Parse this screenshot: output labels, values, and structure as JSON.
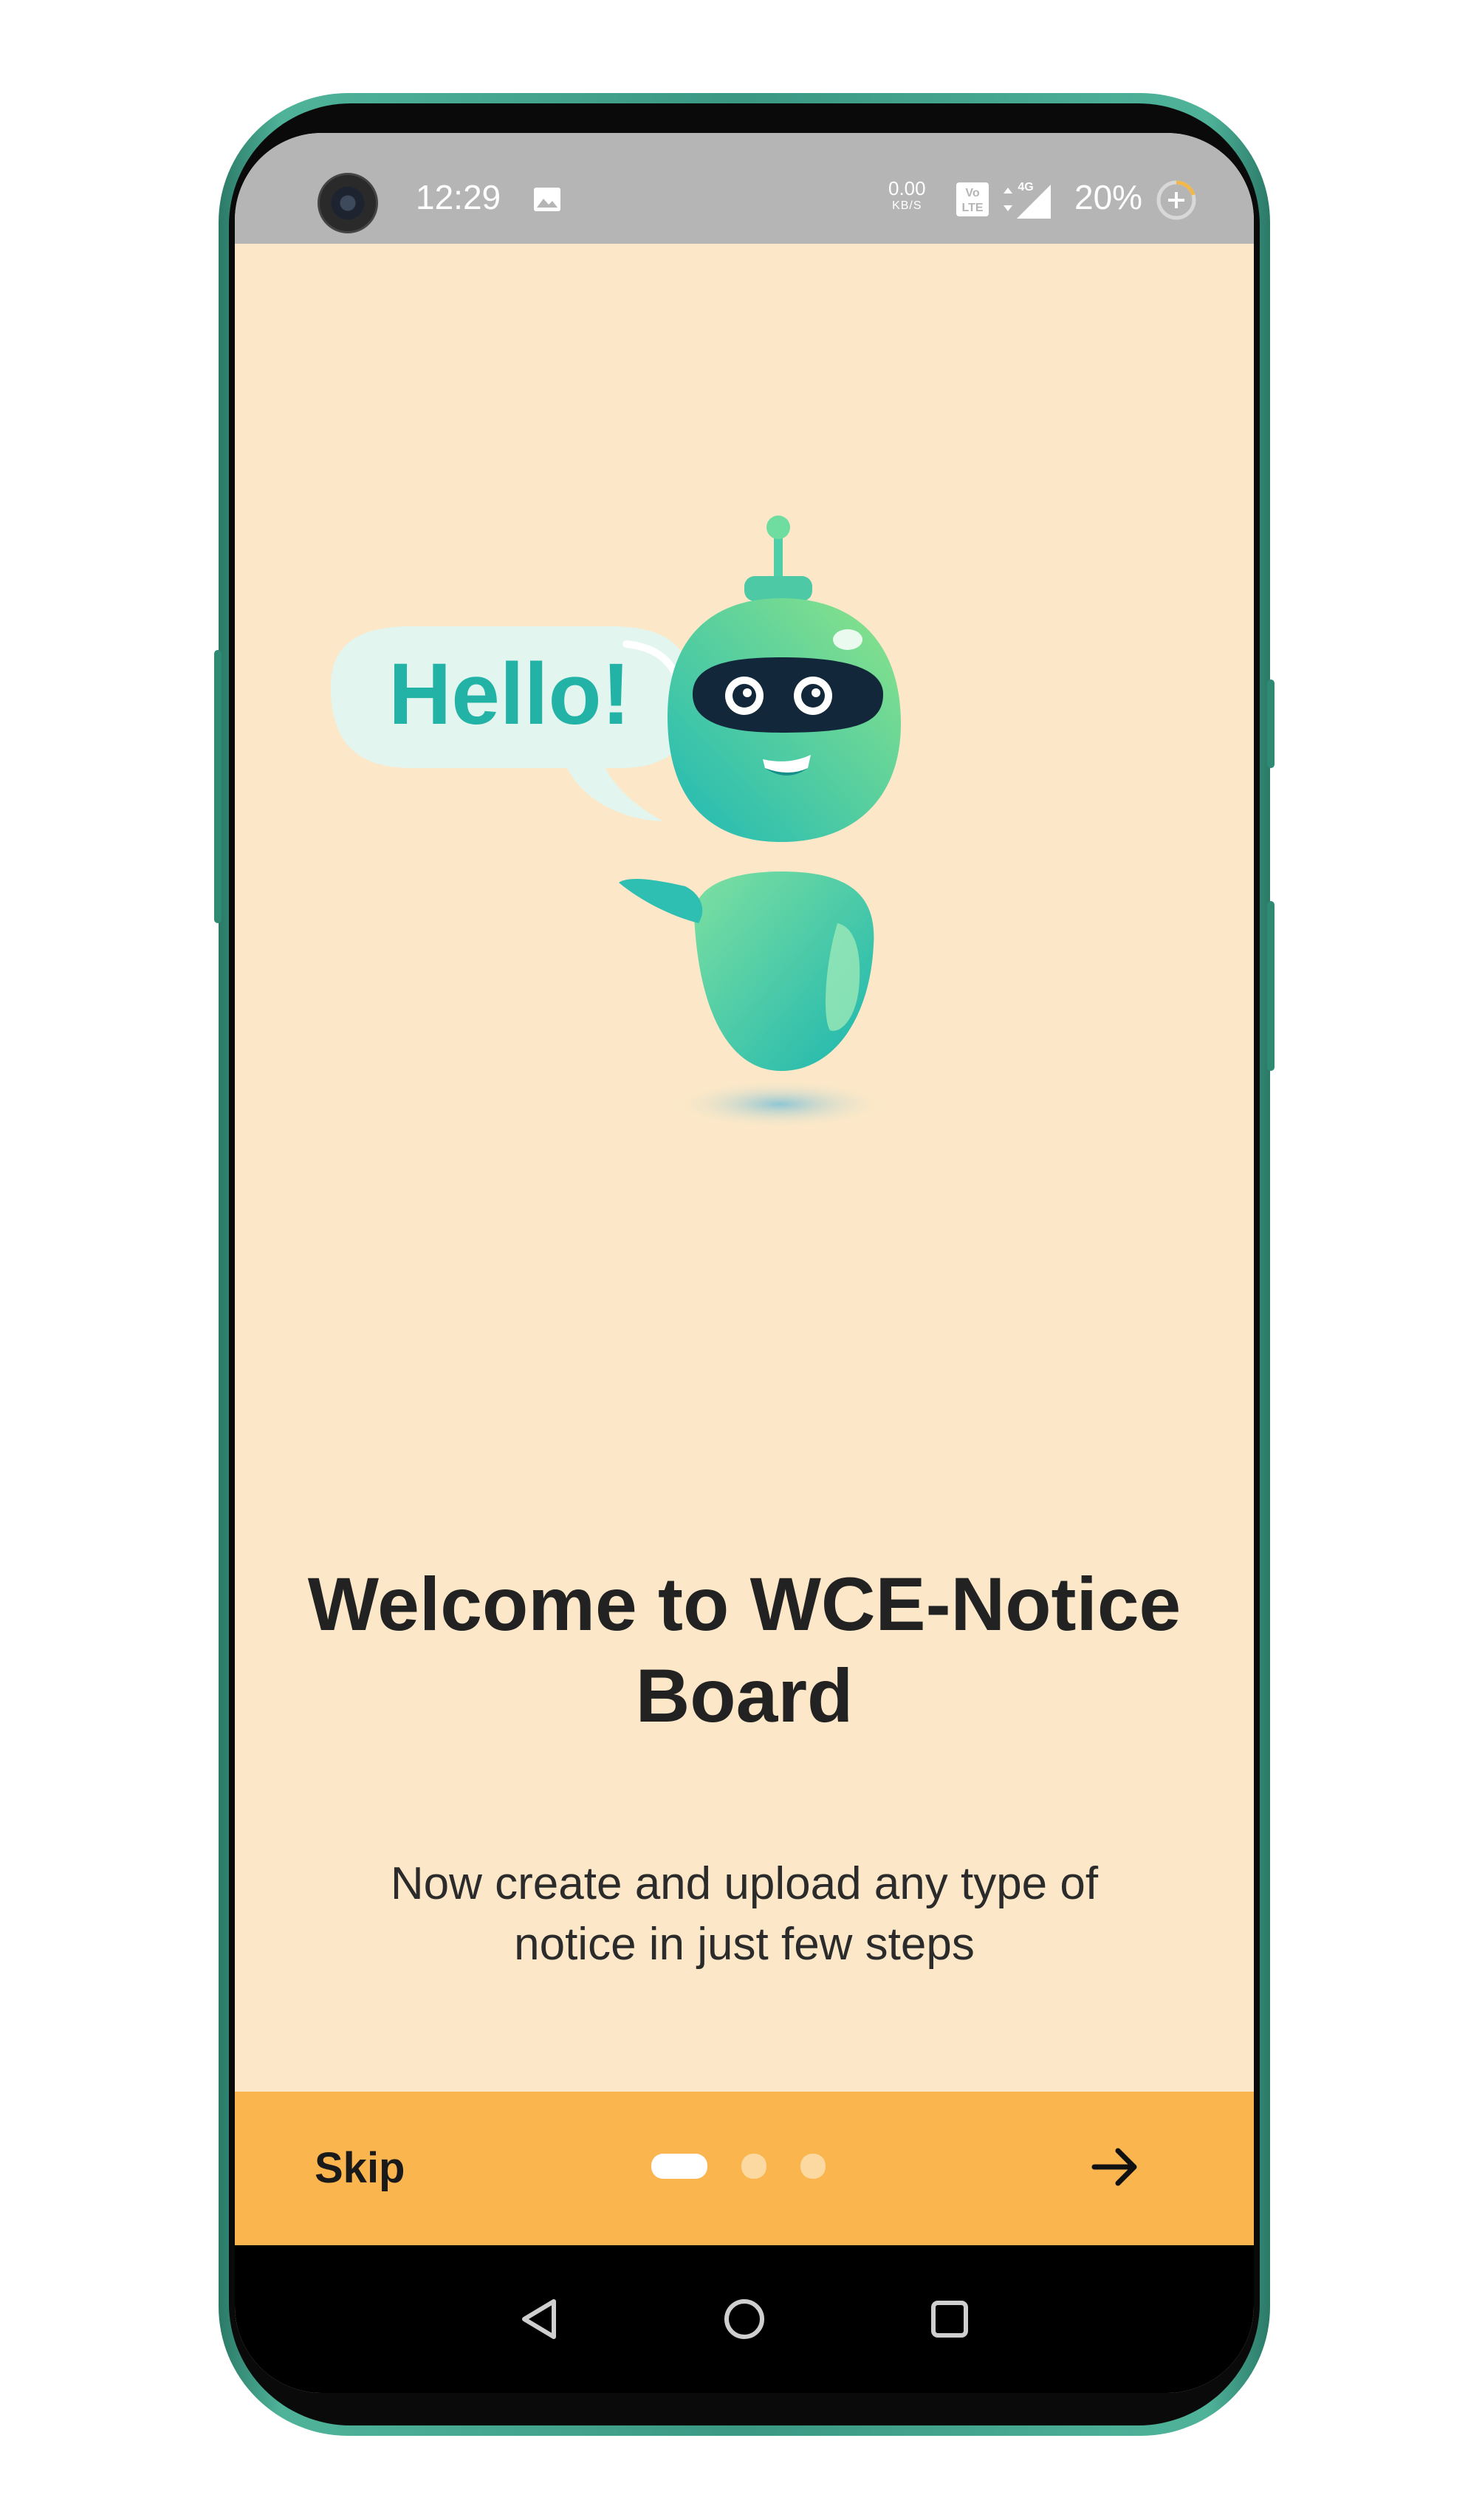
{
  "status_bar": {
    "time": "12:29",
    "net_speed_value": "0.00",
    "net_speed_unit": "KB/S",
    "volte_label_top": "Vo",
    "volte_label_bottom": "LTE",
    "network_type": "4G",
    "battery_percent": "20%",
    "icons": [
      "camera-icon",
      "gallery-icon",
      "volte-icon",
      "signal-icon",
      "battery-icon"
    ]
  },
  "illustration": {
    "speech_bubble_text": "Hello!",
    "colors": {
      "robot_teal": "#2cc6b4",
      "robot_green": "#7fe08a",
      "bubble": "#e4f5ee"
    }
  },
  "onboarding": {
    "title_line1": "Welcome to WCE-Notice",
    "title_line2": "Board",
    "subtitle_line1": "Now create and upload any type of",
    "subtitle_line2": "notice in just few steps",
    "page_count": 3,
    "current_page": 1
  },
  "bottom_bar": {
    "skip_label": "Skip",
    "next_icon": "arrow-right-icon",
    "background_color": "#fbb54f"
  },
  "nav_bar": {
    "icons": [
      "back-triangle-icon",
      "home-circle-icon",
      "recents-square-icon"
    ]
  },
  "colors": {
    "screen_background": "#fce8c8",
    "status_bar": "#b5b5b5",
    "frame": "#3a9883"
  }
}
